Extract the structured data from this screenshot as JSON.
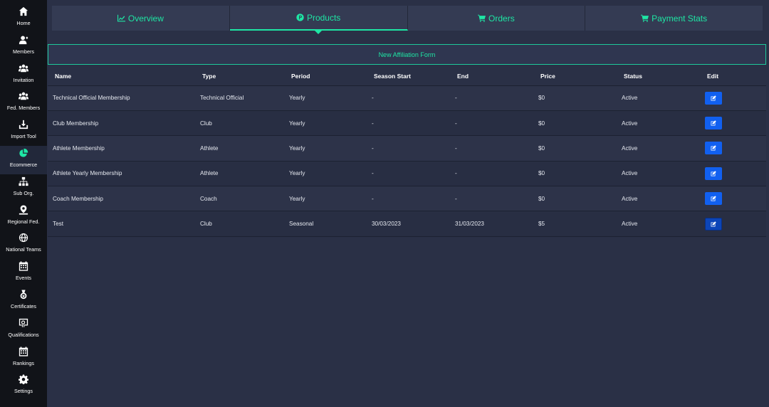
{
  "sidebar": {
    "items": [
      {
        "label": "Home",
        "icon": "home-icon"
      },
      {
        "label": "Members",
        "icon": "user-icon"
      },
      {
        "label": "Invitation",
        "icon": "users-icon"
      },
      {
        "label": "Fed. Members",
        "icon": "users-icon"
      },
      {
        "label": "Import Tool",
        "icon": "download-icon"
      },
      {
        "label": "Ecommerce",
        "icon": "pie-chart-icon",
        "active": true
      },
      {
        "label": "Sub Org.",
        "icon": "sitemap-icon"
      },
      {
        "label": "Regional Fed.",
        "icon": "map-pin-icon"
      },
      {
        "label": "National Teams",
        "icon": "globe-icon"
      },
      {
        "label": "Events",
        "icon": "calendar-icon"
      },
      {
        "label": "Certificates",
        "icon": "medal-icon"
      },
      {
        "label": "Qualifications",
        "icon": "certificate-icon"
      },
      {
        "label": "Rankings",
        "icon": "calendar-grid-icon"
      },
      {
        "label": "Settings",
        "icon": "gear-icon"
      }
    ]
  },
  "tabs": [
    {
      "label": "Overview",
      "icon": "line-chart-icon"
    },
    {
      "label": "Products",
      "icon": "product-circle-icon",
      "active": true
    },
    {
      "label": "Orders",
      "icon": "cart-icon"
    },
    {
      "label": "Payment Stats",
      "icon": "cart-icon"
    }
  ],
  "new_form_label": "New Affiliation Form",
  "table": {
    "headers": [
      "Name",
      "Type",
      "Period",
      "Season Start",
      "End",
      "Price",
      "Status",
      "Edit"
    ],
    "rows": [
      [
        "Technical Official Membership",
        "Technical Official",
        "Yearly",
        "-",
        "-",
        "$0",
        "Active"
      ],
      [
        "Club Membership",
        "Club",
        "Yearly",
        "-",
        "-",
        "$0",
        "Active"
      ],
      [
        "Athlete Membership",
        "Athlete",
        "Yearly",
        "-",
        "-",
        "$0",
        "Active"
      ],
      [
        "Athlete Yearly Membership",
        "Athlete",
        "Yearly",
        "-",
        "-",
        "$0",
        "Active"
      ],
      [
        "Coach Membership",
        "Coach",
        "Yearly",
        "-",
        "-",
        "$0",
        "Active"
      ],
      [
        "Test",
        "Club",
        "Seasonal",
        "30/03/2023",
        "31/03/2023",
        "$5",
        "Active"
      ]
    ]
  },
  "colors": {
    "accent": "#1ee6a4",
    "edit_button": "#1160f0",
    "background": "#2a3046",
    "sidebar": "#111318"
  }
}
